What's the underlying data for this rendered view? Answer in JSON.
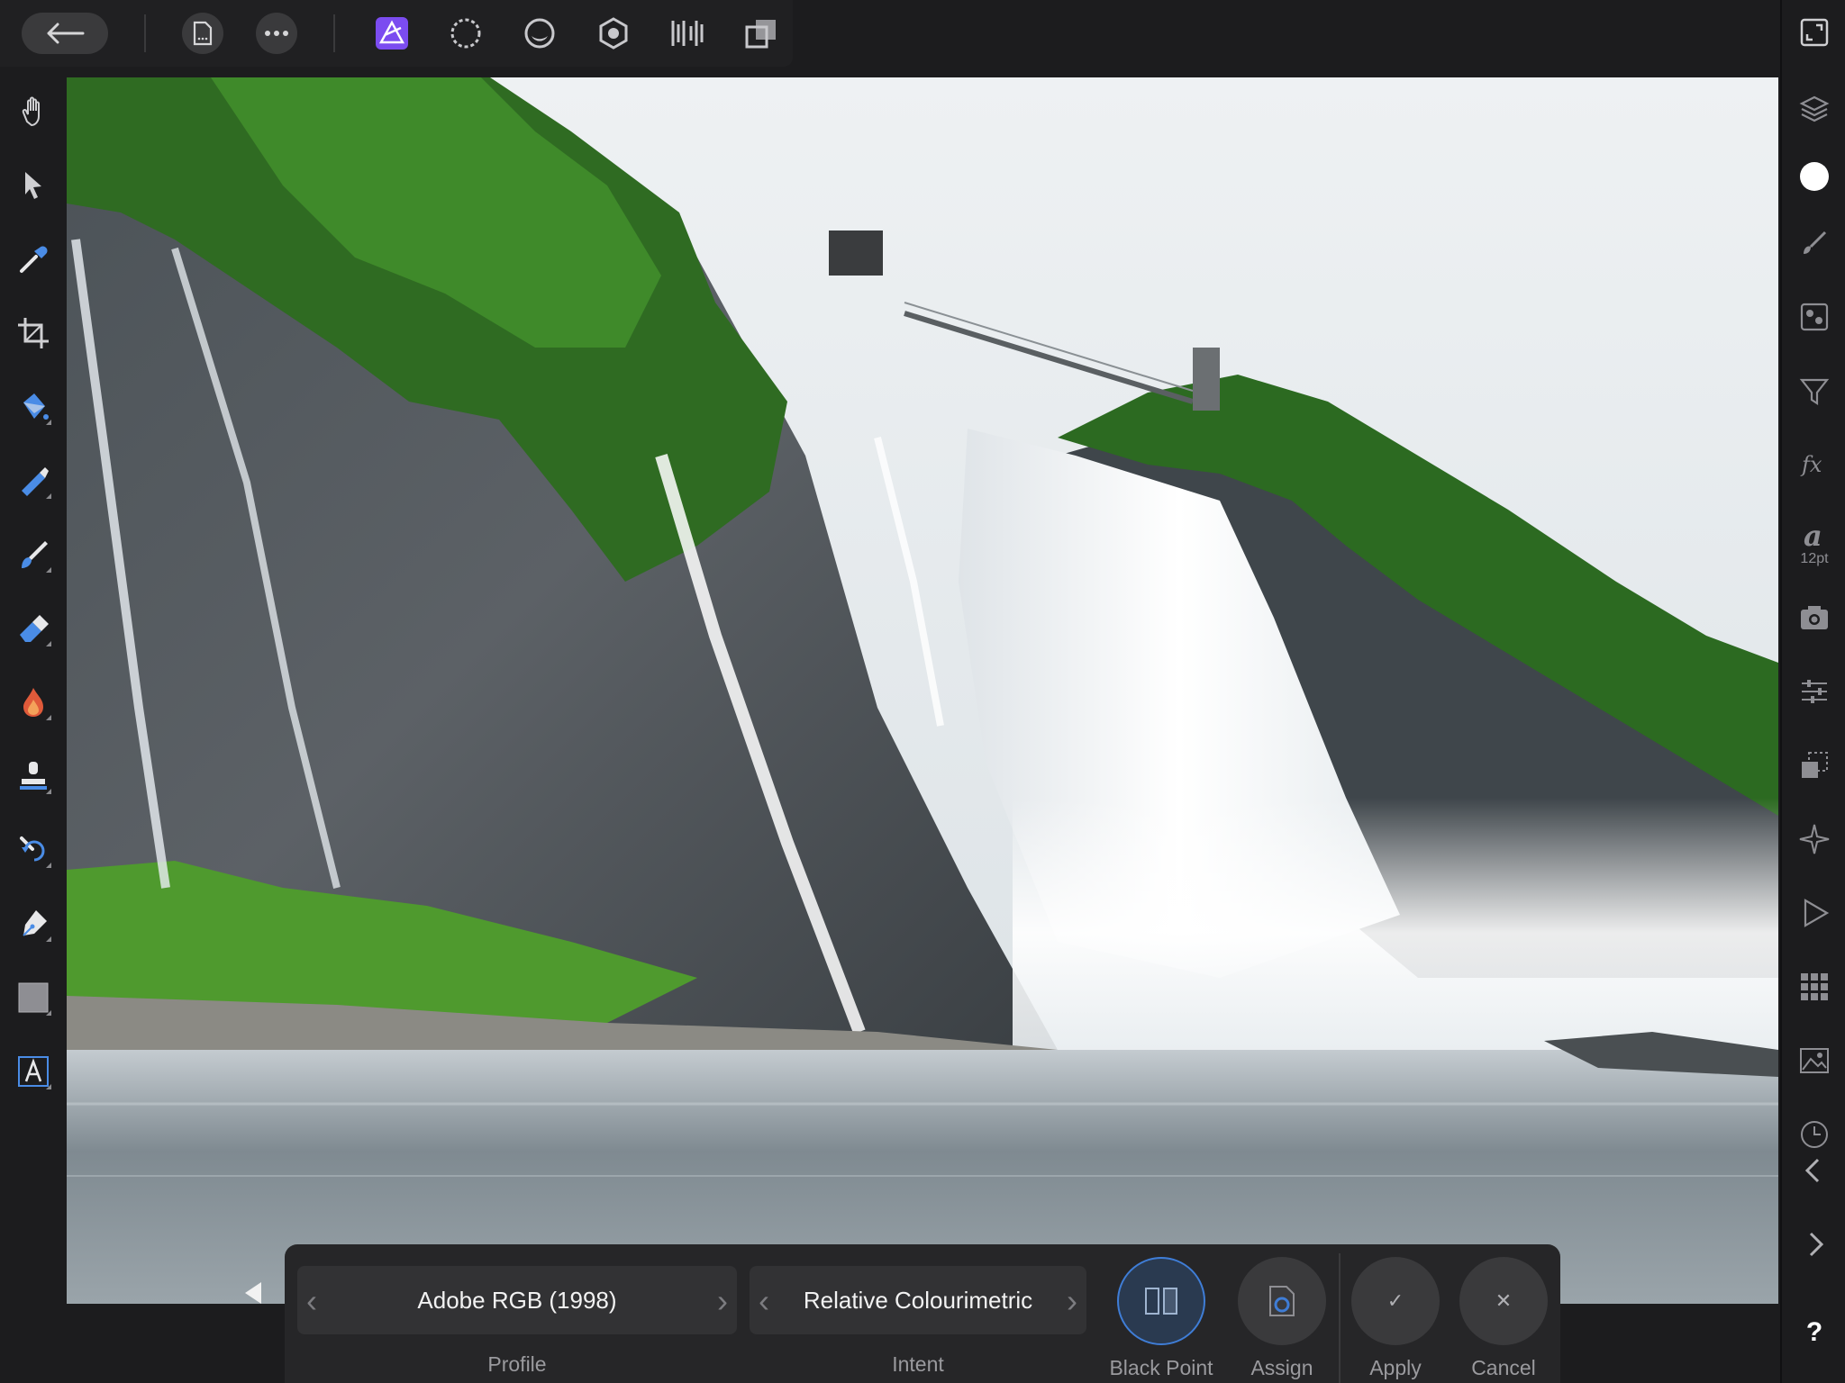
{
  "toolbar": {
    "icons": [
      "back-arrow-icon",
      "document-icon",
      "more-icon",
      "photo-persona-icon",
      "liquify-persona-icon",
      "develop-persona-icon",
      "tone-mapping-persona-icon",
      "export-persona-icon",
      "macro-persona-icon"
    ]
  },
  "left_tools": [
    "hand-icon",
    "move-icon",
    "color-picker-icon",
    "crop-icon",
    "flood-fill-icon",
    "selection-brush-icon",
    "paint-brush-icon",
    "eraser-icon",
    "dodge-burn-icon",
    "clone-stamp-icon",
    "healing-icon",
    "pen-icon",
    "rectangle-icon",
    "text-icon"
  ],
  "right_tools": {
    "text_size": "12pt",
    "help": "?"
  },
  "context_bar": {
    "profile": {
      "value": "Adobe RGB (1998)",
      "label": "Profile"
    },
    "intent": {
      "value": "Relative Colourimetric",
      "label": "Intent"
    },
    "black_point": {
      "label": "Black Point"
    },
    "assign": {
      "label": "Assign"
    },
    "apply": {
      "label": "Apply",
      "glyph": "✓"
    },
    "cancel": {
      "label": "Cancel",
      "glyph": "✕"
    }
  },
  "colors": {
    "accent": "#3f7dd6",
    "persona_active": "#7b4cf0",
    "panel": "#262628",
    "background": "#1c1c1e"
  }
}
